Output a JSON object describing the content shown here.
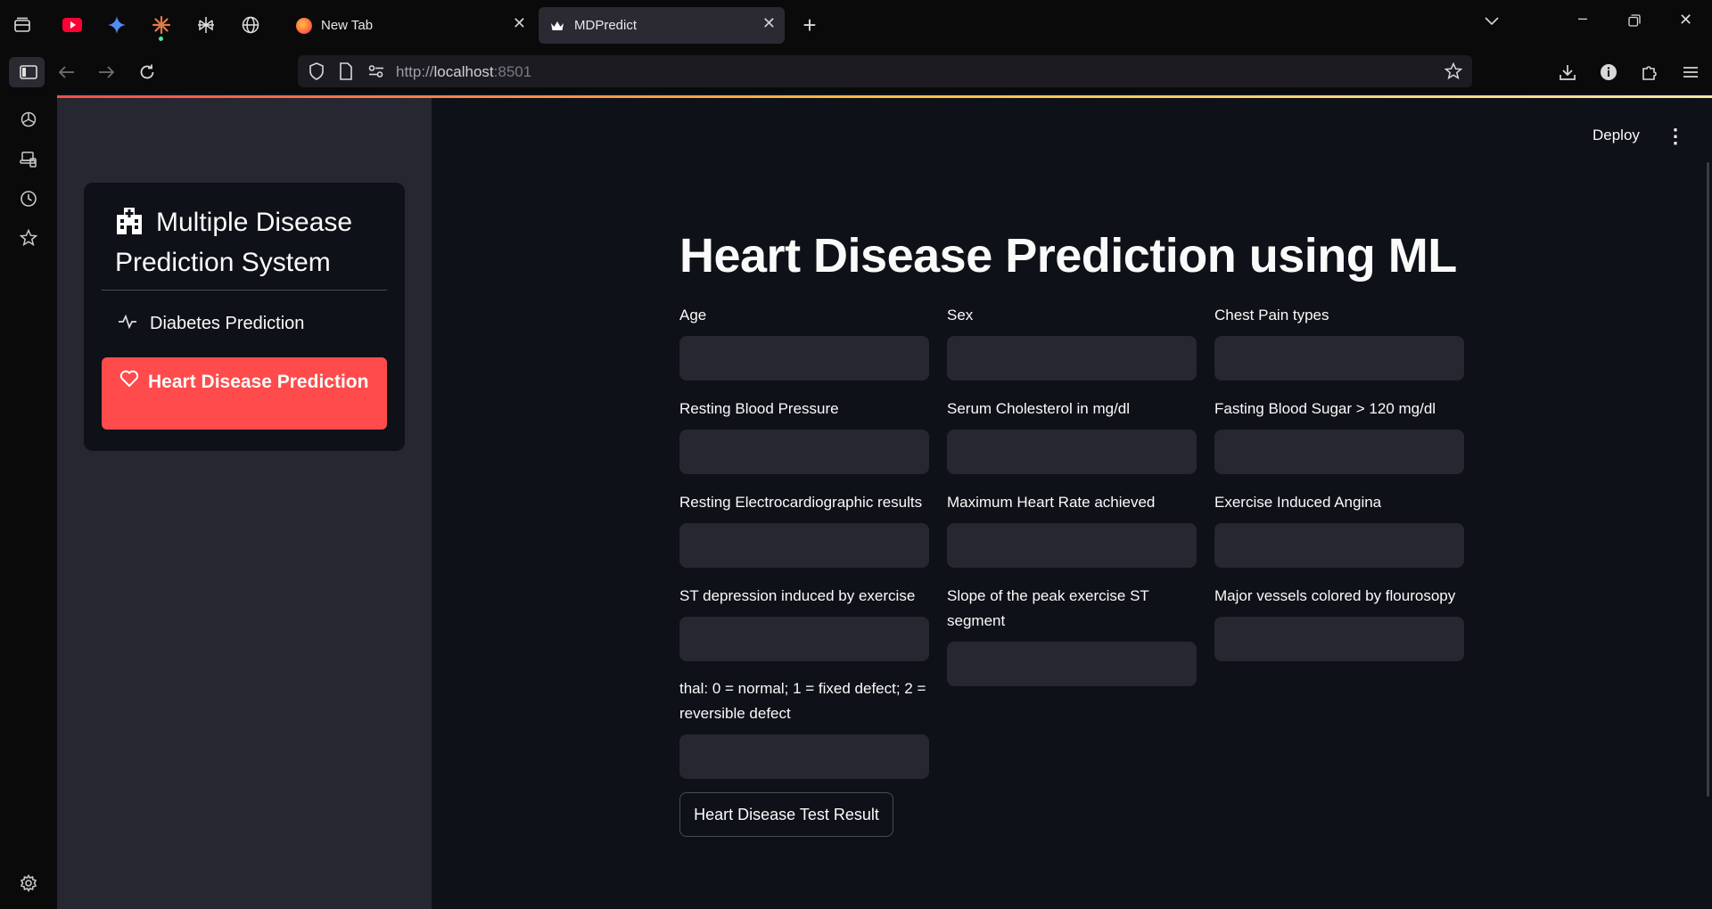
{
  "browser": {
    "tabs": [
      {
        "title": "New Tab",
        "active": false
      },
      {
        "title": "MDPredict",
        "active": true
      }
    ],
    "url": {
      "scheme": "http://",
      "host": "localhost",
      "port": ":8501"
    },
    "new_tab_symbol": "+"
  },
  "sidebar": {
    "title": "Multiple Disease Prediction System",
    "items": [
      {
        "label": "Diabetes Prediction",
        "icon": "activity-icon",
        "selected": false
      },
      {
        "label": "Heart Disease Prediction",
        "icon": "heart-icon",
        "selected": true
      }
    ],
    "accent": "#ff4b4b"
  },
  "header": {
    "deploy_label": "Deploy"
  },
  "main": {
    "title": "Heart Disease Prediction using ML",
    "fields": [
      {
        "label": "Age",
        "value": ""
      },
      {
        "label": "Sex",
        "value": ""
      },
      {
        "label": "Chest Pain types",
        "value": ""
      },
      {
        "label": "Resting Blood Pressure",
        "value": ""
      },
      {
        "label": "Serum Cholesterol in mg/dl",
        "value": ""
      },
      {
        "label": "Fasting Blood Sugar > 120 mg/dl",
        "value": ""
      },
      {
        "label": "Resting Electrocardiographic results",
        "value": ""
      },
      {
        "label": "Maximum Heart Rate achieved",
        "value": ""
      },
      {
        "label": "Exercise Induced Angina",
        "value": ""
      },
      {
        "label": "ST depression induced by exercise",
        "value": ""
      },
      {
        "label": "Slope of the peak exercise ST segment",
        "value": ""
      },
      {
        "label": "Major vessels colored by flourosopy",
        "value": ""
      },
      {
        "label": "thal: 0 = normal; 1 = fixed defect; 2 = reversible defect",
        "value": ""
      }
    ],
    "submit_label": "Heart Disease Test Result"
  }
}
